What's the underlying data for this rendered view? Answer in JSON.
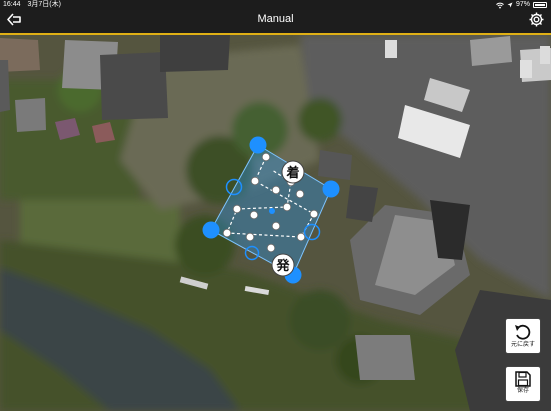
{
  "status_bar": {
    "time": "16:44",
    "date": "3月7日(木)",
    "battery": "97%"
  },
  "header": {
    "title": "Manual",
    "back_icon": "back-arrow-icon",
    "settings_icon": "gear-icon"
  },
  "markers": {
    "start": "発",
    "end": "着"
  },
  "buttons": {
    "undo_label": "元に戻す",
    "save_label": "保存"
  },
  "colors": {
    "accent": "#e0b015",
    "handle": "#1e90ff",
    "area_fill": "#2f8fd8"
  }
}
